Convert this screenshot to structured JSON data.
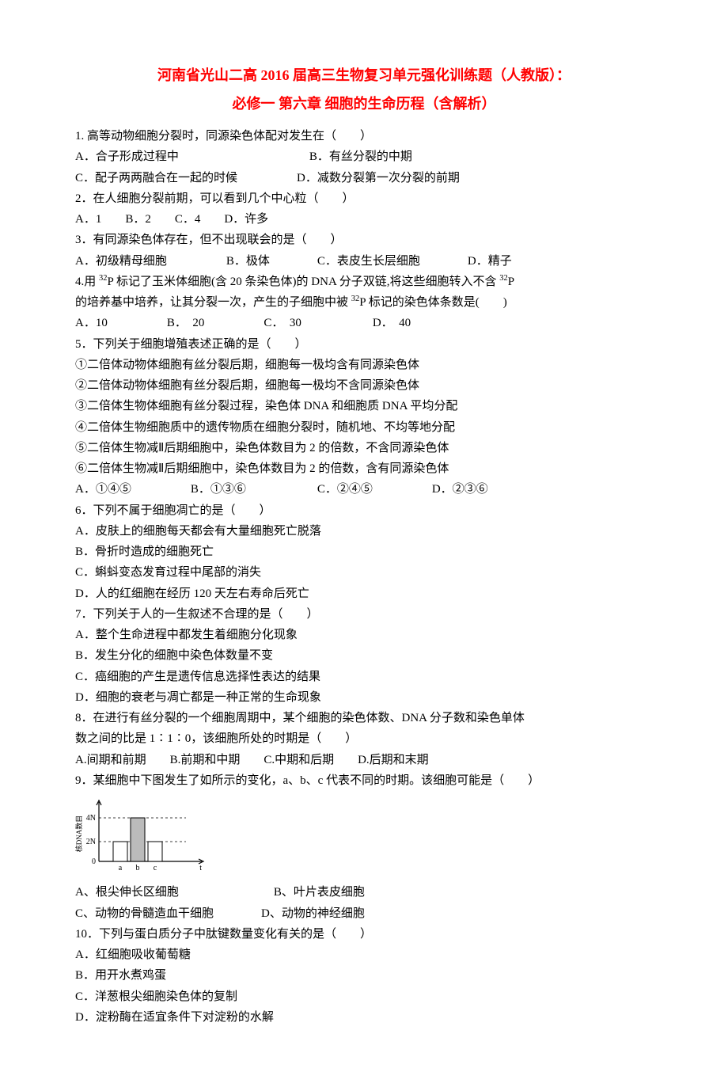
{
  "title_main": "河南省光山二高 2016 届高三生物复习单元强化训练题（人教版）：",
  "title_sub": "必修一 第六章 细胞的生命历程（含解析）",
  "q1": {
    "stem": "1. 高等动物细胞分裂时，同源染色体配对发生在（　　）",
    "a": "A．合子形成过程中",
    "b": "B．有丝分裂的中期",
    "c": "C．配子两两融合在一起的时候",
    "d": "D．减数分裂第一次分裂的前期"
  },
  "q2": {
    "stem": "2．在人细胞分裂前期，可以看到几个中心粒（　　）",
    "opts": "A．1　　B．2　　C．4　　D．许多"
  },
  "q3": {
    "stem": "3．有同源染色体存在，但不出现联会的是（　　）",
    "a": "A．初级精母细胞",
    "b": "B．极体",
    "c": "C．表皮生长层细胞",
    "d": "D．精子"
  },
  "q4": {
    "line1_a": "4.用 ",
    "line1_b": "P 标记了玉米体细胞(含 20 条染色体)的 DNA 分子双链,将这些细胞转入不含 ",
    "line1_c": "P",
    "line2_a": "的培养基中培养，让其分裂一次，产生的子细胞中被 ",
    "line2_b": "P 标记的染色体条数是(　　)",
    "opts": "A．10　　　　　B．　20　　　　　C．　30　　　　　　D．　40"
  },
  "q5": {
    "stem": "5．下列关于细胞增殖表述正确的是（　　）",
    "l1": "①二倍体动物体细胞有丝分裂后期，细胞每一极均含有同源染色体",
    "l2": "②二倍体动物体细胞有丝分裂后期，细胞每一极均不含同源染色体",
    "l3": "③二倍体生物体细胞有丝分裂过程，染色体 DNA 和细胞质 DNA 平均分配",
    "l4": "④二倍体生物细胞质中的遗传物质在细胞分裂时，随机地、不均等地分配",
    "l5": "⑤二倍体生物减Ⅱ后期细胞中，染色体数目为 2 的倍数，不含同源染色体",
    "l6": "⑥二倍体生物减Ⅱ后期细胞中，染色体数目为 2 的倍数，含有同源染色体",
    "opts": "A．①④⑤　　　　　B．①③⑥　　　　　　C．②④⑤　　　　　D．②③⑥"
  },
  "q6": {
    "stem": "6．下列不属于细胞凋亡的是（　　）",
    "a": "A．皮肤上的细胞每天都会有大量细胞死亡脱落",
    "b": "B．骨折时造成的细胞死亡",
    "c": "C．蝌蚪变态发育过程中尾部的消失",
    "d": "D．人的红细胞在经历 120 天左右寿命后死亡"
  },
  "q7": {
    "stem": "7．下列关于人的一生叙述不合理的是（　　）",
    "a": "A．整个生命进程中都发生着细胞分化现象",
    "b": "B．发生分化的细胞中染色体数量不变",
    "c": "C．癌细胞的产生是遗传信息选择性表达的结果",
    "d": "D．细胞的衰老与凋亡都是一种正常的生命现象"
  },
  "q8": {
    "stem1": "8．在进行有丝分裂的一个细胞周期中，某个细胞的染色体数、DNA 分子数和染色单体",
    "stem2": "数之间的比是 1∶1∶0，该细胞所处的时期是（　　）",
    "opts": "A.间期和前期　　B.前期和中期　　C.中期和后期　　D.后期和末期"
  },
  "q9": {
    "stem": "9．某细胞中下图发生了如所示的变化，a、b、c 代表不同的时期。该细胞可能是（　　）",
    "a": "A、根尖伸长区细胞",
    "b": "B、叶片表皮细胞",
    "c": "C、动物的骨髓造血干细胞",
    "d": "D、动物的神经细胞"
  },
  "q10": {
    "stem": "10．下列与蛋白质分子中肽键数量变化有关的是（　　）",
    "a": "A．红细胞吸收葡萄糖",
    "b": "B．用开水煮鸡蛋",
    "c": "C．洋葱根尖细胞染色体的复制",
    "d": "D．淀粉酶在适宜条件下对淀粉的水解"
  },
  "chart_data": {
    "type": "bar",
    "title": "",
    "xlabel": "t",
    "ylabel": "核DNA数目",
    "categories": [
      "a",
      "b",
      "c"
    ],
    "values": [
      2,
      4,
      2
    ],
    "y_ticks": [
      "0",
      "2N",
      "4N"
    ],
    "ylim": [
      0,
      4
    ]
  }
}
